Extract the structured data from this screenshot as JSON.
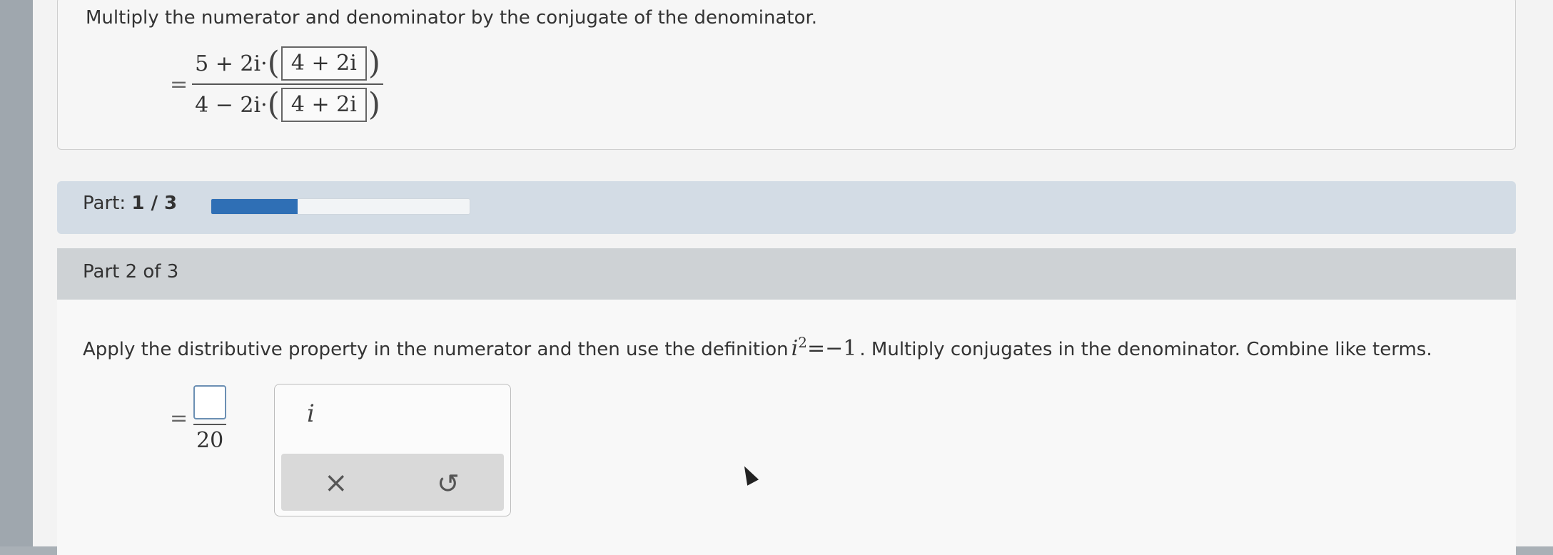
{
  "top_card": {
    "instruction": "Multiply the numerator and denominator by the conjugate of the denominator.",
    "expression": {
      "equals": "=",
      "numerator_left": "5 + 2i·",
      "numerator_boxed": "4 + 2i",
      "denominator_left": "4 − 2i·",
      "denominator_boxed": "4 + 2i"
    }
  },
  "part_bar": {
    "label": "Part:",
    "current": "1 / 3",
    "progress_fraction": 0.333
  },
  "part_section": {
    "header": "Part 2 of 3",
    "instruction_before": "Apply the distributive property in the numerator and then use the definition",
    "instruction_math_base": "i",
    "instruction_math_exp": "2",
    "instruction_math_rest": "=−1",
    "instruction_after": ". Multiply conjugates in the denominator. Combine like terms.",
    "answer": {
      "equals": "=",
      "denominator": "20"
    },
    "keypad": {
      "i_key": "i",
      "clear_key": "×",
      "undo_key": "↺"
    }
  },
  "colors": {
    "progress_fill": "#2f6fb5",
    "part_bar_bg": "#d3dce5",
    "part_header_bg": "#ced2d5"
  }
}
